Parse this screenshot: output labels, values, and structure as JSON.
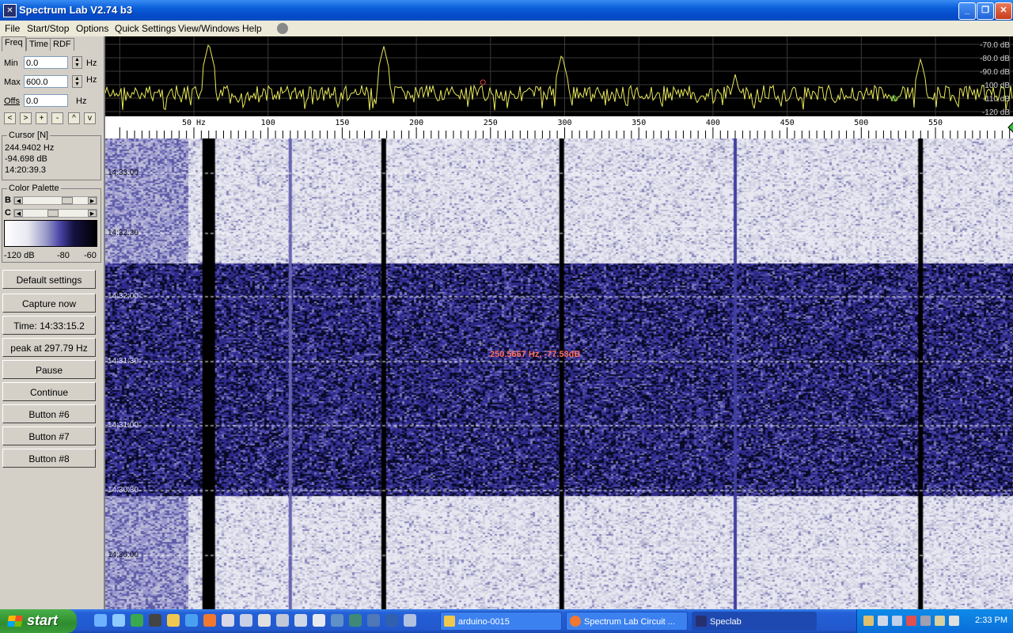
{
  "window": {
    "title": "Spectrum Lab V2.74 b3",
    "minimize_glyph": "_",
    "maximize_glyph": "❐",
    "close_glyph": "✕"
  },
  "menu": [
    "File",
    "Start/Stop",
    "Options",
    "Quick Settings",
    "View/Windows",
    "Help"
  ],
  "panel": {
    "tabs": [
      "Freq",
      "Time",
      "RDF"
    ],
    "min_label": "Min",
    "min_value": "0.0",
    "max_label": "Max",
    "max_value": "600.0",
    "offs_label": "Offs",
    "offs_value": "0.0",
    "unit": "Hz",
    "nav_buttons": [
      "<",
      ">",
      "+",
      "-",
      "^",
      "v"
    ],
    "cursor_title": "Cursor [N]",
    "cursor_freq": "244.9402 Hz",
    "cursor_db": "-94.698 dB",
    "cursor_time": "14:20:39.3",
    "palette_title": "Color Palette",
    "b_label": "B",
    "c_label": "C",
    "pal_min": "-120 dB",
    "pal_mid": "-80",
    "pal_max": "-60",
    "buttons": [
      "Default settings",
      "Capture now",
      "Time:  14:33:15.2",
      "peak at 297.79 Hz",
      "Pause",
      "Continue",
      "Button #6",
      "Button #7",
      "Button #8"
    ]
  },
  "spectrum": {
    "db_labels": [
      "-70.0 dB",
      "-80.0 dB",
      "-90.0 dB",
      "-100 dB",
      "-110 dB",
      "-120 dB"
    ],
    "freq_ticks": [
      "50 Hz",
      "100",
      "150",
      "200",
      "250",
      "300",
      "350",
      "400",
      "450",
      "500",
      "550"
    ],
    "freq_tick_values": [
      50,
      100,
      150,
      200,
      250,
      300,
      350,
      400,
      450,
      500,
      550
    ],
    "freq_min": 0,
    "freq_max": 600,
    "trace_color": "#e8e85a"
  },
  "waterfall": {
    "time_labels": [
      "14:33:00",
      "14:32:30",
      "14:32:00",
      "14:31:30",
      "14:31:00",
      "14:30:30",
      "14:30:00"
    ],
    "cursor_readout": "250.5667 Hz, -77.53dB",
    "colors": {
      "light": "#e4e4ee",
      "dark": "#1c1a5c",
      "line": "#000000"
    }
  },
  "taskbar": {
    "start_label": "start",
    "tasks": [
      "arduino-0015",
      "Spectrum Lab Circuit ...",
      "Speclab"
    ],
    "clock": "2:33 PM"
  }
}
